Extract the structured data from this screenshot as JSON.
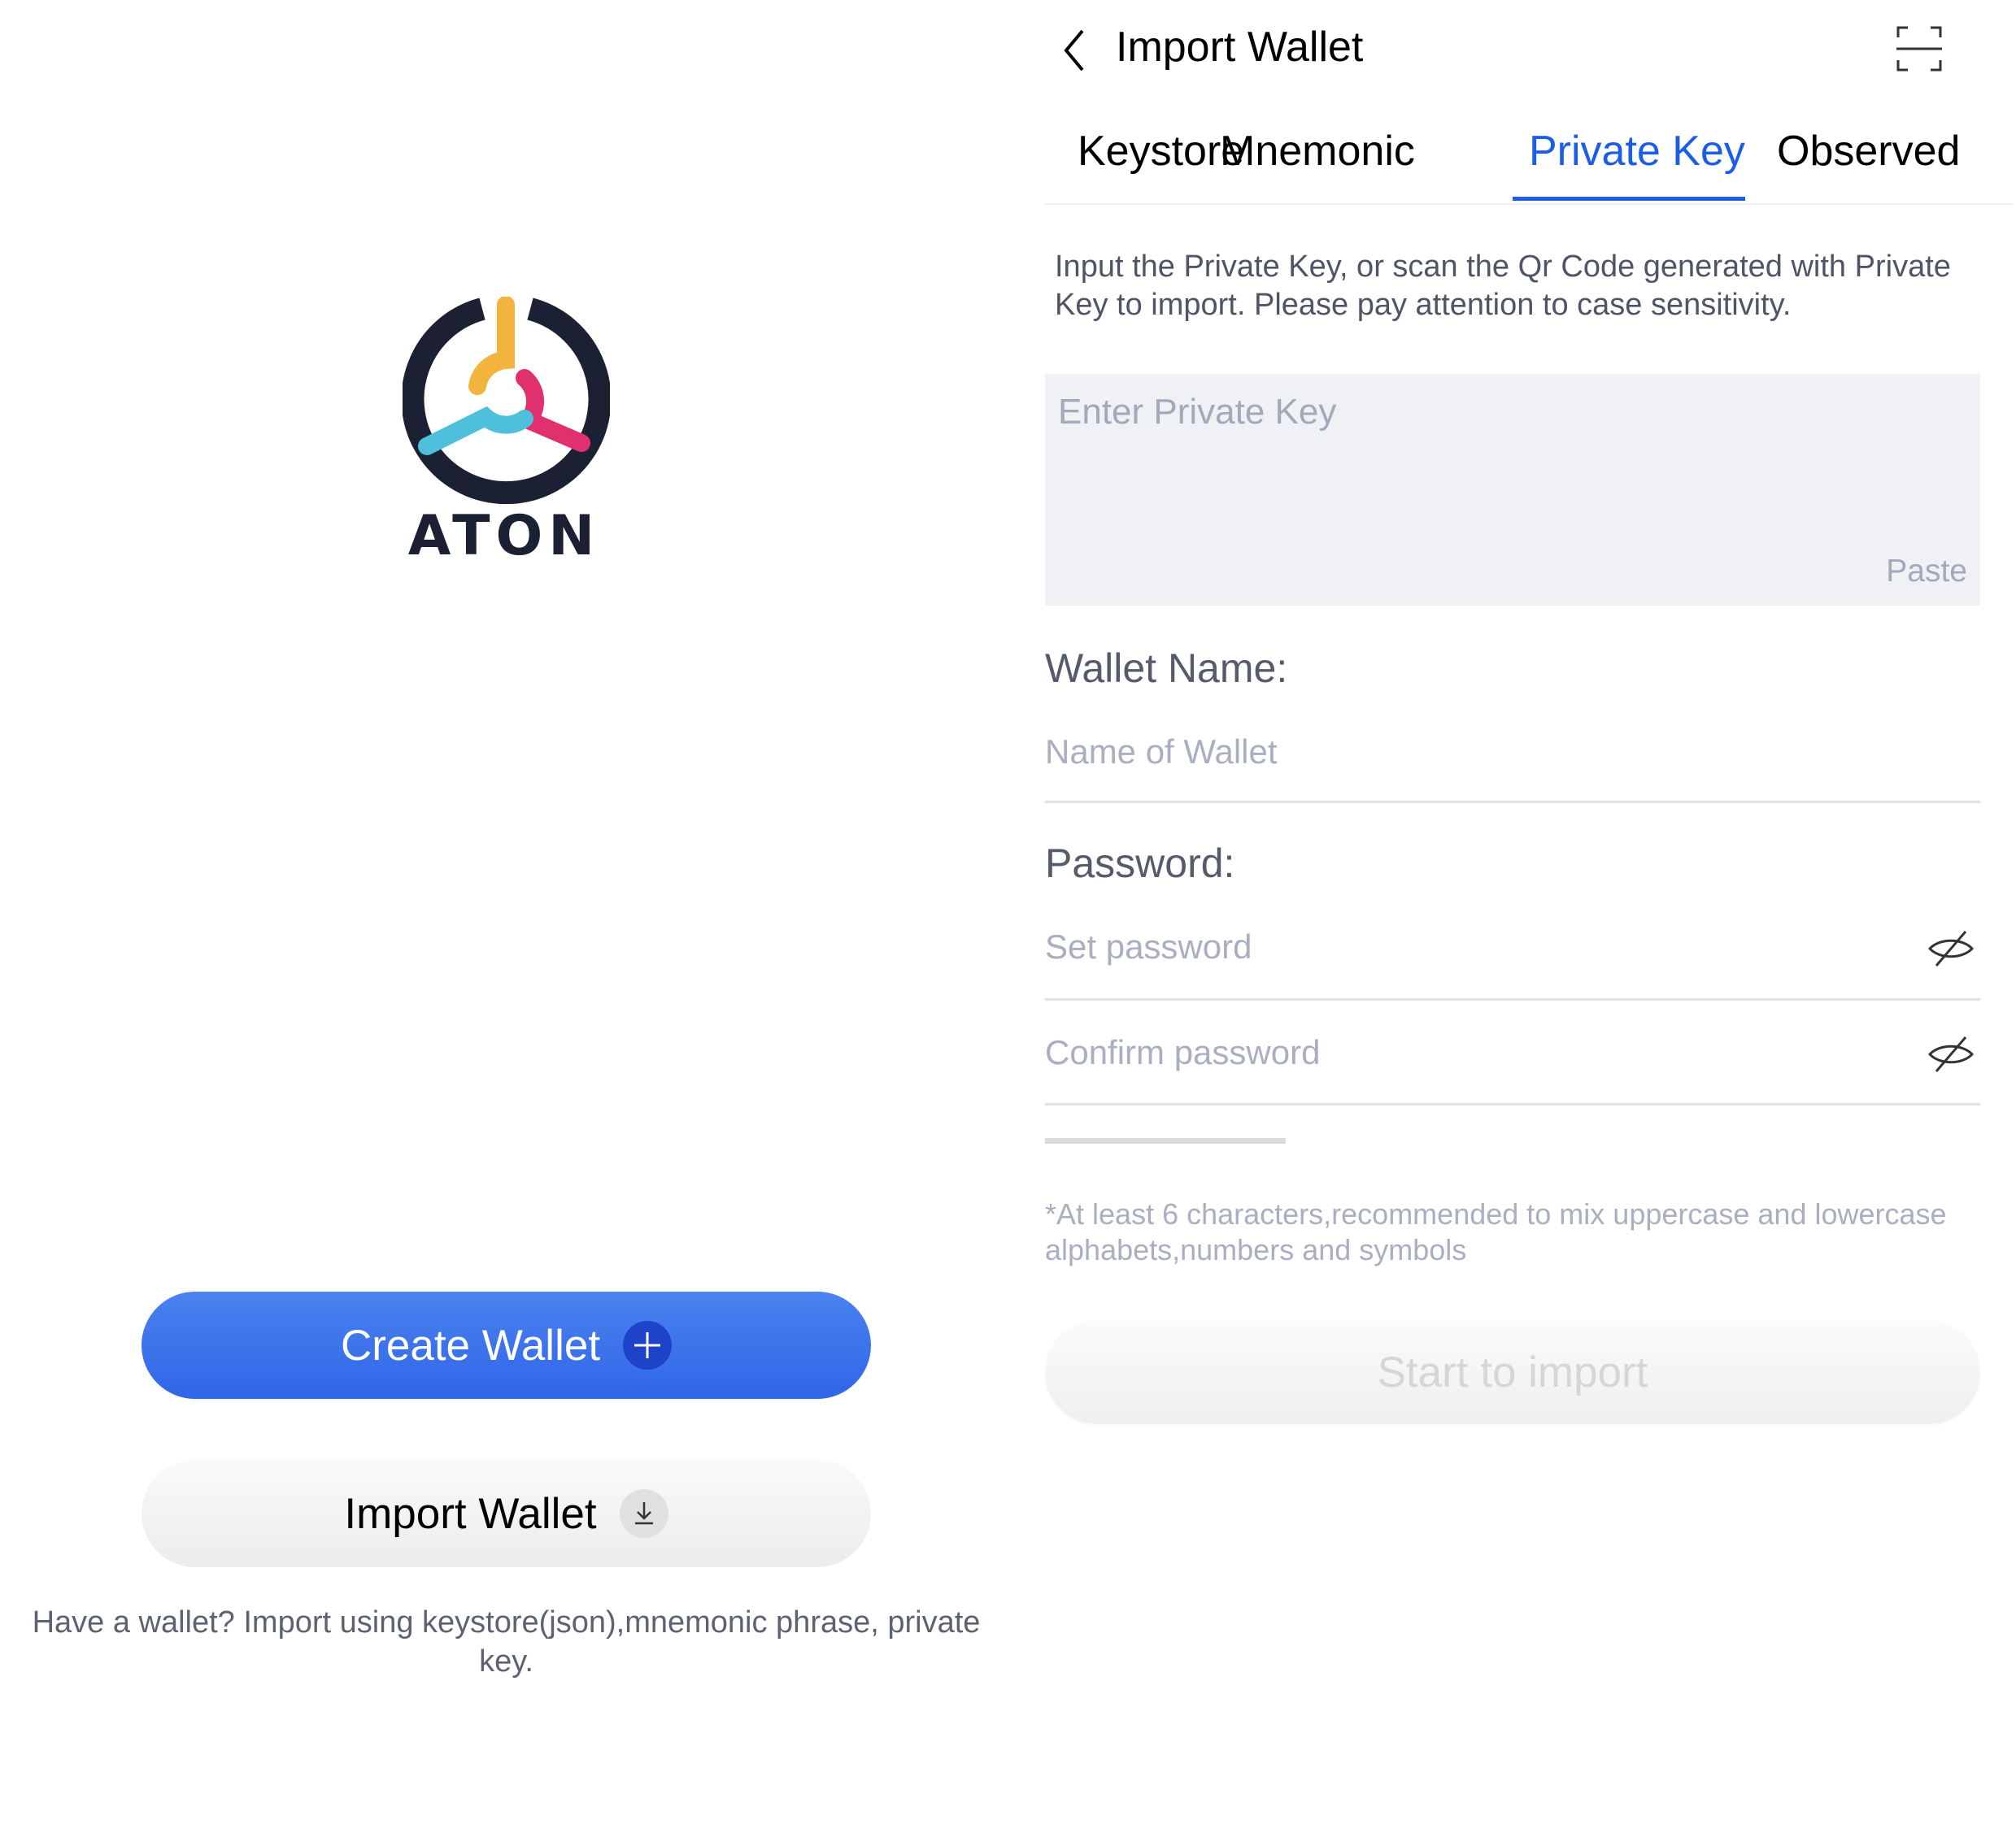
{
  "welcome": {
    "brand": "ATON",
    "create_label": "Create Wallet",
    "import_label": "Import Wallet",
    "hint": "Have a wallet? Import using keystore(json),mnemonic phrase, private key."
  },
  "import": {
    "title": "Import Wallet",
    "tabs": [
      {
        "label": "Keystore"
      },
      {
        "label": "Mnemonic"
      },
      {
        "label": "Private Key",
        "active": true
      },
      {
        "label": "Observed"
      }
    ],
    "instructions": "Input the Private Key, or scan the Qr Code generated with Private Key to import. Please pay attention to case sensitivity.",
    "key_placeholder": "Enter Private Key",
    "paste_label": "Paste",
    "wallet_name_label": "Wallet Name:",
    "wallet_name_placeholder": "Name of Wallet",
    "password_label": "Password:",
    "set_password_placeholder": "Set password",
    "confirm_password_placeholder": "Confirm password",
    "password_hint": "*At least 6 characters,recommended to mix uppercase and lowercase alphabets,numbers and symbols",
    "start_label": "Start to import"
  },
  "icons": {
    "back": "chevron-left-icon",
    "scan": "scan-icon",
    "eye": "eye-hidden-icon",
    "plus": "plus-icon",
    "download": "download-icon"
  },
  "colors": {
    "accent": "#1c5de6",
    "primary_button": "#3a72ea",
    "logo_dark": "#1c2033",
    "logo_yellow": "#f2b43c",
    "logo_pink": "#e0306e",
    "logo_cyan": "#4fc0dc",
    "field_bg": "#f0f1f5",
    "placeholder": "#a9aec1"
  }
}
